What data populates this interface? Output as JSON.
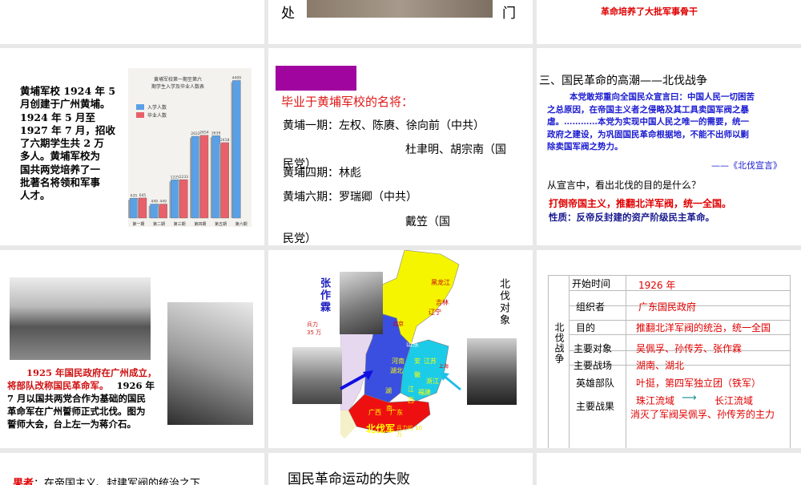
{
  "slides": {
    "top_mid": {
      "left_char": "处",
      "right_char": "门"
    },
    "top_right": {
      "caption": "革命培养了大批军事骨干"
    },
    "whampoa_intro": {
      "lines": [
        "黄埔军校 1924 年 5",
        "月创建于广州黄埔。",
        "1924 年 5 月至",
        "1927 年 7 月，招收",
        "了六期学生共 2 万",
        "多人。黄埔军校为",
        "国共两党培养了一",
        "批著名将领和军事",
        "人才。"
      ]
    },
    "famous_generals": {
      "title": "毕业于黄埔军校的名将：",
      "lines": [
        "黄埔一期：左权、陈赓、徐向前（中共）",
        "杜聿明、胡宗南（国",
        "民党）",
        "黄埔四期：林彪",
        "黄埔六期：罗瑞卿（中共）",
        "戴笠（国",
        "民党）"
      ]
    },
    "northern_expedition": {
      "heading": "三、国民革命的高潮——北伐战争",
      "quote_lines": [
        "本党敢郑重向全国民众宣言曰：中国人民一切困苦",
        "之总原因，在帝国主义者之侵略及其工具卖国军阀之暴",
        "虐。…………本党为实现中国人民之唯一的需要，统一",
        "政府之建设，为巩固国民革命根据地，不能不出师以剿",
        "除卖国军阀之势力。"
      ],
      "source": "——《北伐宣言》",
      "question": "从宣言中，看出北伐的目的是什么？",
      "answer": "打倒帝国主义，推翻北洋军阀，统一全国。",
      "nature": "性质：反帝反封建的资产阶级民主革命。"
    },
    "oath_rally": {
      "red_lines": [
        "1925 年国民政府在广州成立，",
        "将部队改称国民革命军。"
      ],
      "black_tail": "1926 年",
      "lines": [
        "7 月以国共两党合作为基础的国民",
        "革命军在广州誓师正式北伐。图为",
        "誓师大会，台上左一为蒋介石。"
      ]
    },
    "map": {
      "zhang_name": "张作霖",
      "zhang_force": "兵力 35 万",
      "targets_label": "北伐对象",
      "army_label": "北伐军",
      "army_force": "兵力约 10 万",
      "provinces": [
        "黑龙江",
        "吉林",
        "辽宁",
        "北京",
        "山东",
        "河南",
        "湖北",
        "湖",
        "南",
        "安",
        "徽",
        "江苏",
        "上海",
        "浙江",
        "江",
        "西",
        "福建",
        "广西",
        "广东"
      ]
    },
    "summary_table": {
      "side_label": "北伐战争",
      "rows": [
        {
          "key": "开始时间",
          "value": "1926 年"
        },
        {
          "key": "组织者",
          "value": "广东国民政府"
        },
        {
          "key": "目的",
          "value": "推翻北洋军阀的统治，统一全国"
        },
        {
          "key": "主要对象",
          "value": "吴佩孚、孙传芳、张作霖"
        },
        {
          "key": "主要战场",
          "value": "湖南、湖北"
        },
        {
          "key": "英雄部队",
          "value": "叶挺，第四军独立团（铁军）"
        },
        {
          "key": "主要战果",
          "value": "珠江流域",
          "value_to": "长江流域",
          "value2": "消灭了军阀吴佩孚、孙传芳的主力"
        }
      ]
    },
    "bottom_left": {
      "red": "果者",
      "text": "：在帝国主义、封建军阀的统治之下"
    },
    "bottom_mid": {
      "title": "国民革命运动的失败"
    }
  },
  "chart_data": {
    "type": "bar",
    "title": "黄埔军校第一期至第六期学生入学及毕业人数表",
    "categories": [
      "第一期",
      "第二期",
      "第三期",
      "第四期",
      "第五期",
      "第六期"
    ],
    "series": [
      {
        "name": "入学人数",
        "color": "#5aa0e6",
        "values": [
          635,
          449,
          1225,
          2622,
          2639,
          4409
        ]
      },
      {
        "name": "毕业人数",
        "color": "#e8606a",
        "values": [
          645,
          449,
          1233,
          2654,
          2418,
          null
        ]
      }
    ],
    "ylim": [
      0,
      4600
    ],
    "legend": "top-left"
  }
}
